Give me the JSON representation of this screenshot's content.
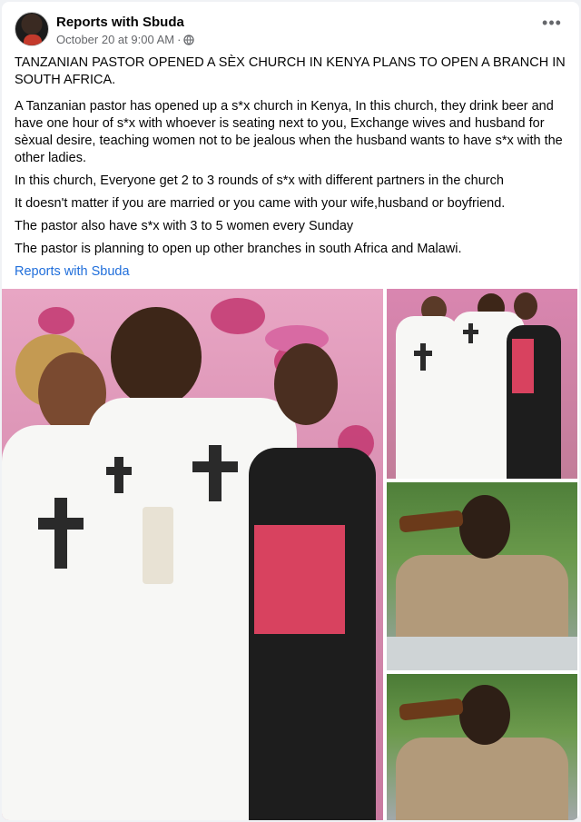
{
  "post": {
    "page_name": "Reports with Sbuda",
    "timestamp": "October 20 at 9:00 AM",
    "separator": "·",
    "audience_icon": "globe-icon",
    "more_icon": "ellipsis-icon",
    "more_label": "•••",
    "paragraphs": [
      "TANZANIAN PASTOR OPENED A SÈX CHURCH IN KENYA PLANS TO OPEN A BRANCH IN SOUTH AFRICA.",
      "A Tanzanian pastor has opened up a s*x church in Kenya, In this church, they drink beer and have one hour of s*x with whoever is seating next to you, Exchange wives and husband for sèxual desire, teaching women not to be jealous when the husband wants to have s*x with the other ladies.",
      "In this church, Everyone get 2 to 3 rounds of s*x with different partners in the church",
      "It doesn't matter if you are married or you came with your wife,husband or boyfriend.",
      "The pastor also have s*x with 3 to 5 women every Sunday",
      "The pastor is planning to open up other branches in south Africa and Malawi."
    ],
    "link_text": "Reports with Sbuda"
  },
  "photos": {
    "main": "photo-kiss-robes",
    "top_right": "photo-group-robes",
    "mid_right": "photo-man-drinking",
    "bottom_right": "photo-man-drinking-2"
  },
  "colors": {
    "link": "#216fdb",
    "meta": "#65676b",
    "text": "#050505"
  }
}
